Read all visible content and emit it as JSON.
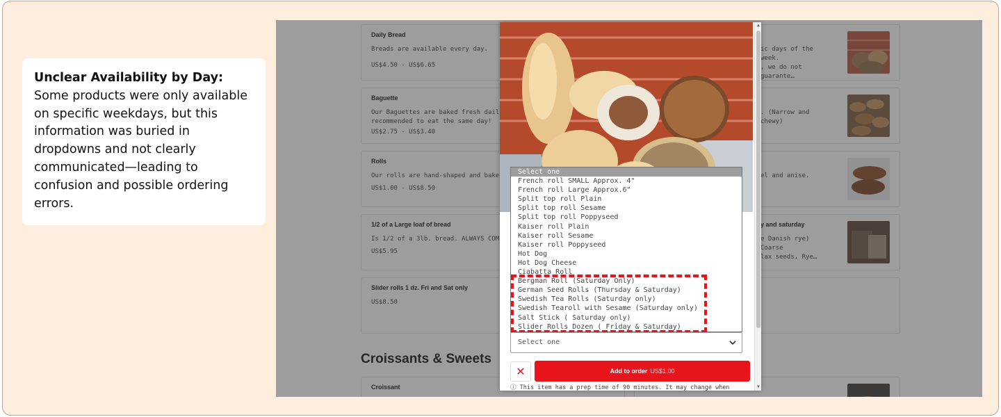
{
  "callout": {
    "heading": "Unclear Availability by Day:",
    "body": " Some products were only available on specific weekdays, but this information was buried in dropdowns and not clearly communicated—leading to confusion and possible ordering errors."
  },
  "menu": {
    "left_cards": [
      {
        "name": "Daily Bread",
        "desc": "Breads are available every day.",
        "price": "US$4.50 - US$6.65"
      },
      {
        "name": "Baguette",
        "desc": "Our Baguettes are baked fresh daily\nrecommended to eat the same day!",
        "price": "US$2.75 - US$3.40"
      },
      {
        "name": "Rolls",
        "desc": "Our rolls are hand-shaped and baked",
        "price": "US$1.00 - US$8.50"
      },
      {
        "name": "1/2 of a Large loaf of bread",
        "desc": "Is 1/2 of a 3lb. bread. ALWAYS COME",
        "price": "US$5.95"
      },
      {
        "name": "Slider rolls 1 dz. Fri and Sat only",
        "desc": "",
        "price": "US$8.50"
      }
    ],
    "right_cards": [
      {
        "name": "",
        "desc": "ic days of the week.\n, we do not guarante…"
      },
      {
        "name": "",
        "desc": ". (Narrow and chewy)"
      },
      {
        "name": "",
        "desc": "el and anise."
      },
      {
        "name": "y and saturday",
        "desc": "e Danish rye) Coarse\nlax seeds, Rye…"
      }
    ],
    "section_title": "Croissants & Sweets",
    "croissant_name": "Croissant",
    "right_bottom_fragment": ")"
  },
  "modal": {
    "list_options": [
      "Select one",
      "French roll SMALL Approx. 4\"",
      "French roll Large Approx.6\"",
      "Split top roll Plain",
      "Split top roll Sesame",
      "Split top roll Poppyseed",
      "Kaiser roll Plain",
      "Kaiser roll Sesame",
      "Kaiser roll Poppyseed",
      "Hot Dog",
      "Hot Dog Cheese",
      "Ciabatta Roll",
      "Bergman Roll (Saturday Only)",
      "German Seed Rolls (Thursday & Saturday)",
      "Swedish Tea Rolls (Saturday only)",
      "Swedish Tearoll with Sesame (Saturday only)",
      "Salt Stick ( Saturday only)",
      "Slider Rolls Dozen ( Friday & Saturday)"
    ],
    "second_select": "Select one",
    "close_glyph": "✕",
    "add_label": "Add to order",
    "add_price": "US$1.00",
    "prep_note": "ⓘ This item has a prep time of 90 minutes. It may change when"
  },
  "colors": {
    "accent": "#e8141c",
    "frame": "#fdeee0"
  }
}
